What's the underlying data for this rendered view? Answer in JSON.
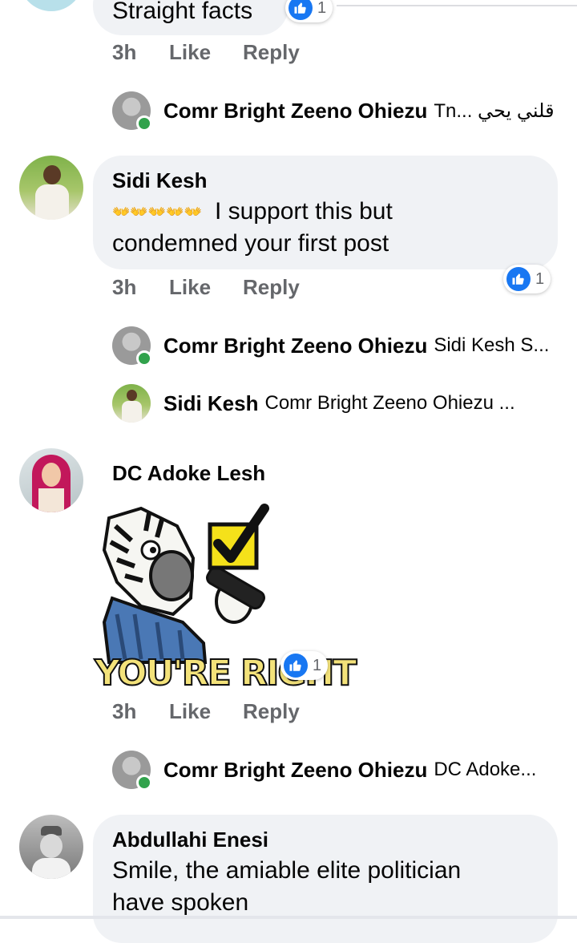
{
  "top_comment": {
    "text": "Straight facts",
    "reaction_count": "1",
    "time": "3h",
    "like_label": "Like",
    "reply_label": "Reply",
    "reply_preview": {
      "author": "Comr Bright Zeeno Ohiezu",
      "text": "Tn... قلني يحي"
    }
  },
  "comments": [
    {
      "author": "Sidi Kesh",
      "emoji_text": "👐👐👐👐👐",
      "text_line1": "I support  this but",
      "text_line2": "condemned  your first  post",
      "reaction_count": "1",
      "time": "3h",
      "like_label": "Like",
      "reply_label": "Reply",
      "replies": [
        {
          "author": "Comr Bright Zeeno Ohiezu",
          "text": "Sidi Kesh S..."
        },
        {
          "author": "Sidi Kesh",
          "text": "Comr Bright Zeeno Ohiezu  ..."
        }
      ]
    },
    {
      "author": "DC Adoke Lesh",
      "sticker_text": "YOU'RE RIGHT",
      "reaction_count": "1",
      "time": "3h",
      "like_label": "Like",
      "reply_label": "Reply",
      "replies": [
        {
          "author": "Comr Bright Zeeno Ohiezu",
          "text": "DC Adoke..."
        }
      ]
    },
    {
      "author": "Abdullahi Enesi",
      "text_line1": "Smile, the amiable elite politician",
      "text_line2": "have spoken"
    }
  ],
  "colors": {
    "like_blue": "#1877f2",
    "bubble_bg": "#f0f2f5",
    "meta_gray": "#65676b",
    "online_green": "#31a24c"
  },
  "icons": [
    "like-thumb-icon",
    "online-status-icon",
    "avatar-icon"
  ]
}
